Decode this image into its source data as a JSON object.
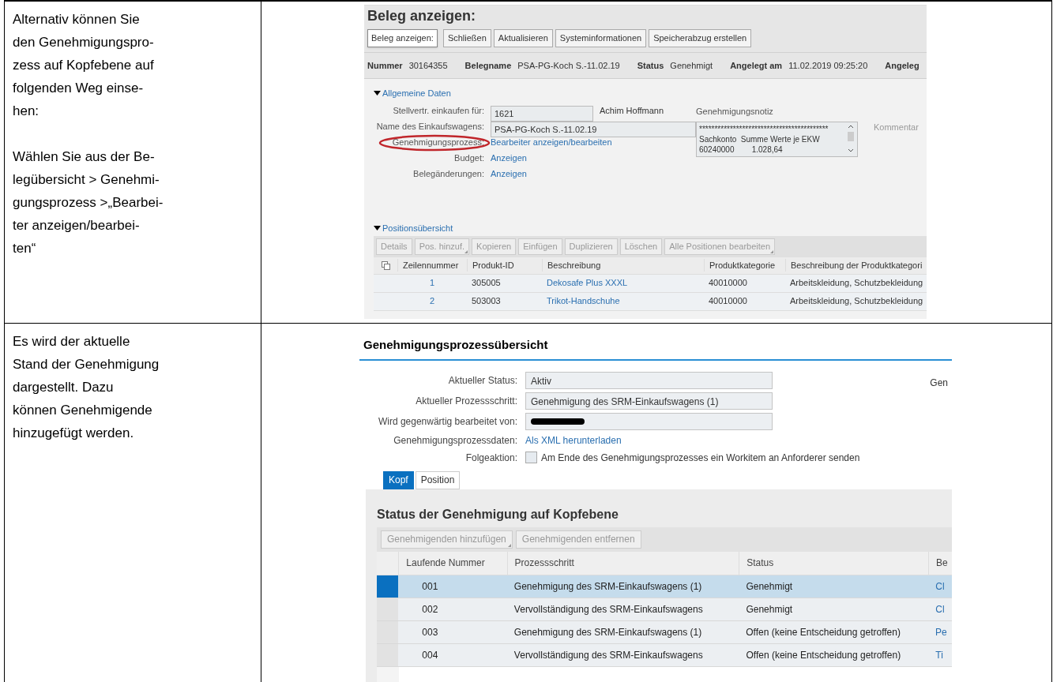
{
  "step_1": {
    "paragraphs": [
      {
        "lines": [
          "Alternativ können Sie",
          "den Genehmigungspro-",
          "zess auf Kopfebene auf",
          "folgenden Weg einse-",
          "hen:"
        ]
      },
      {
        "lines": [
          "Wählen Sie aus der Be-",
          "legübersicht > Genehmi-",
          "gungsprozess >„Bearbei-",
          "ter anzeigen/bearbei-",
          "ten“"
        ]
      }
    ],
    "screen": {
      "title": "Beleg anzeigen:",
      "toolbar": [
        {
          "label": "Beleg anzeigen:",
          "kind": "tooltip"
        },
        {
          "label": "Schließen",
          "kind": "button"
        },
        {
          "label": "Aktualisieren",
          "kind": "button"
        },
        {
          "label": "Systeminformationen",
          "kind": "button"
        },
        {
          "label": "Speicherabzug erstellen",
          "kind": "button"
        }
      ],
      "header_fields": [
        {
          "label": "Nummer",
          "value": "30164355"
        },
        {
          "label": "Belegname",
          "value": "PSA-PG-Koch S.-11.02.19"
        },
        {
          "label": "Status",
          "value": "Genehmigt"
        },
        {
          "label": "Angelegt am",
          "value": "11.02.2019 09:25:20"
        },
        {
          "label": "Angeleg"
        }
      ],
      "general": {
        "title": "Allgemeine Daten",
        "expanded": true,
        "form": [
          {
            "label": "Stellvertr. einkaufen für:",
            "kind": "field",
            "value": "1621",
            "extra": "Achim Hoffmann",
            "circled": false
          },
          {
            "label": "Name des Einkaufswagens:",
            "kind": "field",
            "value": "PSA-PG-Koch S.-11.02.19",
            "circled": false
          },
          {
            "label": "Genehmigungsprozess:",
            "kind": "link",
            "value": "Bearbeiter anzeigen/bearbeiten",
            "circled": true
          },
          {
            "label": "Budget:",
            "kind": "link",
            "value": "Anzeigen",
            "circled": false
          },
          {
            "label": "Belegänderungen:",
            "kind": "link",
            "value": "Anzeigen",
            "circled": false
          }
        ],
        "note": {
          "label": "Genehmigungsnotiz",
          "lines": [
            "******************************************",
            "Sachkonto  Summe Werte je EKW",
            "60240000        1.028,64"
          ]
        },
        "comment_label": "Kommentar"
      },
      "positions": {
        "title": "Positionsübersicht",
        "expanded": true,
        "toolbar": [
          {
            "label": "Details",
            "dropdown": false
          },
          {
            "label": "Pos. hinzuf.",
            "dropdown": true
          },
          {
            "label": "Kopieren",
            "dropdown": false
          },
          {
            "label": "Einfügen",
            "dropdown": false
          },
          {
            "label": "Duplizieren",
            "dropdown": false
          },
          {
            "label": "Löschen",
            "dropdown": false
          },
          {
            "label": "Alle Positionen bearbeiten",
            "dropdown": true
          }
        ],
        "columns": [
          "Zeilennummer",
          "Produkt-ID",
          "Beschreibung",
          "Produktkategorie",
          "Beschreibung der Produktkategori"
        ],
        "rows": [
          [
            "1",
            "305005",
            "Dekosafe Plus XXXL",
            "40010000",
            "Arbeitskleidung, Schutzbekleidung"
          ],
          [
            "2",
            "503003",
            "Trikot-Handschuhe",
            "40010000",
            "Arbeitskleidung, Schutzbekleidung"
          ]
        ]
      }
    }
  },
  "step_2": {
    "paragraphs": [
      {
        "lines": [
          "Es wird der aktuelle",
          "Stand der Genehmigung",
          "dargestellt. Dazu",
          "können Genehmigende",
          "hinzugefügt werden."
        ]
      }
    ],
    "screen": {
      "title": "Genehmigungsprozessübersicht",
      "side_label": "Gen",
      "form": [
        {
          "label": "Aktueller Status:",
          "kind": "field",
          "value": "Aktiv"
        },
        {
          "label": "Aktueller Prozessschritt:",
          "kind": "field",
          "value": "Genehmigung des SRM-Einkaufswagens (1)"
        },
        {
          "label": "Wird gegenwärtig bearbeitet von:",
          "kind": "redacted"
        },
        {
          "label": "Genehmigungsprozessdaten:",
          "kind": "link",
          "value": "Als XML herunterladen"
        },
        {
          "label": "Folgeaktion:",
          "kind": "checkbox",
          "checked": false,
          "value": "Am Ende des Genehmigungsprozesses ein Workitem an Anforderer senden"
        }
      ],
      "tabs": [
        {
          "label": "Kopf",
          "selected": true
        },
        {
          "label": "Position",
          "selected": false
        }
      ],
      "panel_title": "Status der Genehmigung auf Kopfebene",
      "toolbar": [
        {
          "label": "Genehmigenden hinzufügen",
          "dropdown": true
        },
        {
          "label": "Genehmigenden entfernen",
          "dropdown": false
        }
      ],
      "columns": [
        "Laufende Nummer",
        "Prozessschritt",
        "Status",
        "Be"
      ],
      "rows": [
        {
          "cells": [
            "001",
            "Genehmigung des SRM-Einkaufswagens (1)",
            "Genehmigt",
            "Cl"
          ],
          "selected": true
        },
        {
          "cells": [
            "002",
            "Vervollständigung des SRM-Einkaufswagens",
            "Genehmigt",
            "Cl"
          ],
          "selected": false
        },
        {
          "cells": [
            "003",
            "Genehmigung des SRM-Einkaufswagens (1)",
            "Offen (keine Entscheidung getroffen)",
            "Pe"
          ],
          "selected": false
        },
        {
          "cells": [
            "004",
            "Vervollständigung des SRM-Einkaufswagens",
            "Offen (keine Entscheidung getroffen)",
            "Ti"
          ],
          "selected": false
        }
      ]
    }
  }
}
